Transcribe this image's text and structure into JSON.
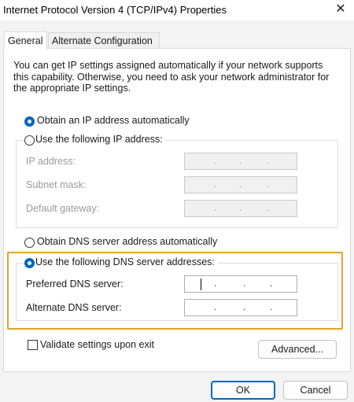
{
  "window": {
    "title": "Internet Protocol Version 4 (TCP/IPv4) Properties",
    "close_glyph": "✕"
  },
  "tabs": [
    {
      "label": "General",
      "active": true
    },
    {
      "label": "Alternate Configuration",
      "active": false
    }
  ],
  "intro_text": "You can get IP settings assigned automatically if your network supports this capability. Otherwise, you need to ask your network administrator for the appropriate IP settings.",
  "ip_section": {
    "auto_label": "Obtain an IP address automatically",
    "auto_selected": true,
    "manual_label": "Use the following IP address:",
    "manual_selected": false,
    "fields": [
      {
        "label": "IP address:",
        "value": ". . ."
      },
      {
        "label": "Subnet mask:",
        "value": ". . ."
      },
      {
        "label": "Default gateway:",
        "value": ". . ."
      }
    ]
  },
  "dns_section": {
    "auto_label": "Obtain DNS server address automatically",
    "auto_selected": false,
    "manual_label": "Use the following DNS server addresses:",
    "manual_selected": true,
    "fields": [
      {
        "label": "Preferred DNS server:",
        "value": ". . ."
      },
      {
        "label": "Alternate DNS server:",
        "value": ". . ."
      }
    ]
  },
  "validate": {
    "label": "Validate settings upon exit",
    "checked": false
  },
  "buttons": {
    "advanced": "Advanced...",
    "ok": "OK",
    "cancel": "Cancel"
  },
  "colors": {
    "accent": "#0067c0",
    "highlight": "#e3a42b"
  }
}
